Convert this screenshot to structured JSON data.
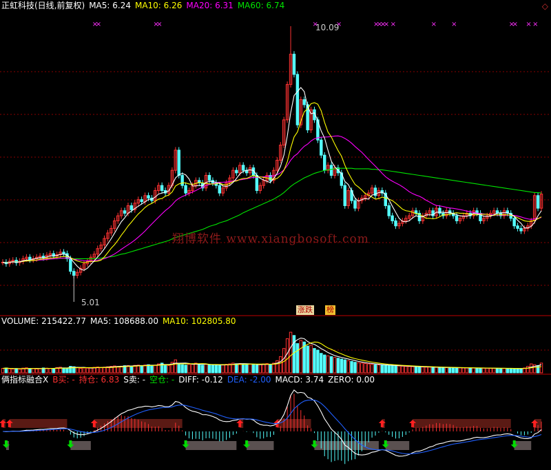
{
  "header": {
    "name": "正虹科技(日线,前复权)",
    "ma5": "MA5: 6.24",
    "ma10": "MA10: 6.26",
    "ma20": "MA20: 6.31",
    "ma60": "MA60: 6.74"
  },
  "annotations": {
    "high": "10.09",
    "low": "5.01",
    "watermark": "翔博软件 www.xiangbosoft.com",
    "badge_updown": "涨跌",
    "badge_rank": "榜"
  },
  "volume_header": {
    "volume": "VOLUME: 215422.77",
    "ma5": "MA5: 108688.00",
    "ma10": "MA10: 102805.80"
  },
  "indicator_header": {
    "name": "俩指标融合X",
    "b_sell": "B买: -",
    "hold": "持仓: 6.83",
    "s_sell": "S卖: -",
    "empty": "空仓: -",
    "diff": "DIFF: -0.12",
    "dea": "DEA: -2.00",
    "macd": "MACD: 3.74",
    "zero": "ZERO: 0.00"
  },
  "colors": {
    "up": "#ff3232",
    "down": "#54ffff",
    "ma5": "#ffffff",
    "ma10": "#ffff00",
    "ma20": "#ff00ff",
    "ma60": "#00e600",
    "grid": "#8b0000",
    "dea": "#2060ff",
    "buy_arrow": "#ff2020",
    "sell_arrow": "#00dd00",
    "hold_box": "#5a1a14",
    "empty_box": "#5a5050"
  },
  "chart_data": {
    "type": "candlestick",
    "price_ylim": [
      4.6,
      10.4
    ],
    "x": [
      1,
      2,
      3,
      4,
      5,
      6,
      7,
      8,
      9,
      10,
      11,
      12,
      13,
      14,
      15,
      16,
      17,
      18,
      19,
      20,
      21,
      22,
      23,
      24,
      25,
      26,
      27,
      28,
      29,
      30,
      31,
      32,
      33,
      34,
      35,
      36,
      37,
      38,
      39,
      40,
      41,
      42,
      43,
      44,
      45,
      46,
      47,
      48,
      49,
      50,
      51,
      52,
      53,
      54,
      55,
      56,
      57,
      58,
      59,
      60,
      61,
      62,
      63,
      64,
      65,
      66,
      67,
      68,
      69,
      70,
      71,
      72,
      73,
      74,
      75,
      76,
      77,
      78,
      79,
      80,
      81,
      82,
      83,
      84,
      85,
      86,
      87,
      88,
      89,
      90,
      91,
      92,
      93,
      94,
      95,
      96,
      97,
      98,
      99,
      100,
      101,
      102,
      103,
      104,
      105,
      106,
      107,
      108,
      109,
      110,
      111,
      112,
      113,
      114,
      115,
      116,
      117,
      118,
      119,
      120,
      121,
      122,
      123,
      124,
      125,
      126,
      127,
      128,
      129,
      130,
      131,
      132,
      133,
      134,
      135,
      136,
      137,
      138,
      139,
      140,
      141,
      142,
      143,
      144,
      145,
      146,
      147,
      148,
      149,
      150,
      151,
      152,
      153,
      154,
      155,
      156,
      157,
      158,
      159,
      160
    ],
    "close": [
      5.48,
      5.45,
      5.5,
      5.52,
      5.47,
      5.5,
      5.55,
      5.58,
      5.53,
      5.55,
      5.58,
      5.6,
      5.57,
      5.62,
      5.65,
      5.6,
      5.63,
      5.68,
      5.65,
      5.55,
      5.3,
      5.22,
      5.28,
      5.36,
      5.45,
      5.5,
      5.58,
      5.64,
      5.75,
      5.82,
      5.95,
      6.06,
      6.15,
      6.3,
      6.4,
      6.5,
      6.45,
      6.6,
      6.52,
      6.65,
      6.72,
      6.68,
      6.8,
      6.75,
      6.7,
      6.9,
      7.0,
      6.9,
      6.85,
      7.0,
      7.3,
      7.7,
      7.2,
      7.0,
      6.85,
      6.9,
      7.0,
      7.1,
      7.05,
      6.95,
      7.2,
      7.1,
      7.05,
      7.0,
      6.85,
      6.95,
      7.05,
      7.15,
      7.3,
      7.25,
      7.4,
      7.3,
      7.25,
      7.35,
      7.2,
      6.9,
      7.0,
      7.1,
      7.2,
      7.1,
      7.3,
      7.5,
      7.8,
      8.3,
      9.0,
      9.6,
      9.2,
      8.2,
      8.7,
      8.6,
      8.1,
      8.5,
      8.3,
      7.9,
      7.6,
      7.3,
      7.4,
      7.2,
      7.35,
      7.25,
      7.0,
      6.6,
      6.9,
      6.7,
      6.55,
      6.7,
      6.75,
      6.8,
      6.85,
      6.95,
      6.8,
      6.9,
      6.85,
      6.6,
      6.4,
      6.3,
      6.2,
      6.25,
      6.3,
      6.35,
      6.4,
      6.5,
      6.45,
      6.3,
      6.4,
      6.45,
      6.5,
      6.4,
      6.55,
      6.45,
      6.4,
      6.5,
      6.45,
      6.4,
      6.3,
      6.35,
      6.4,
      6.45,
      6.4,
      6.5,
      6.45,
      6.3,
      6.35,
      6.4,
      6.45,
      6.5,
      6.45,
      6.4,
      6.5,
      6.45,
      6.35,
      6.2,
      6.15,
      6.1,
      6.15,
      6.2,
      6.3,
      6.8,
      6.55,
      6.83
    ],
    "ma5": [
      5.48,
      5.465,
      5.477,
      5.488,
      5.484,
      5.488,
      5.508,
      5.524,
      5.526,
      5.542,
      5.558,
      5.568,
      5.566,
      5.584,
      5.604,
      5.608,
      5.614,
      5.636,
      5.642,
      5.622,
      5.562,
      5.476,
      5.4,
      5.342,
      5.322,
      5.362,
      5.434,
      5.506,
      5.584,
      5.658,
      5.748,
      5.844,
      5.944,
      6.056,
      6.172,
      6.282,
      6.36,
      6.45,
      6.494,
      6.544,
      6.588,
      6.634,
      6.674,
      6.724,
      6.73,
      6.77,
      6.83,
      6.85,
      6.87,
      6.89,
      7.01,
      7.15,
      7.21,
      7.24,
      7.21,
      7.13,
      6.99,
      6.99,
      7.0,
      7.0,
      7.06,
      7.08,
      7.08,
      7.06,
      7.04,
      6.99,
      6.98,
      7.0,
      7.06,
      7.14,
      7.23,
      7.28,
      7.3,
      7.31,
      7.3,
      7.2,
      7.14,
      7.11,
      7.08,
      7.06,
      7.14,
      7.24,
      7.38,
      7.6,
      7.98,
      8.44,
      8.78,
      8.86,
      8.94,
      8.86,
      8.56,
      8.42,
      8.44,
      8.28,
      8.08,
      7.94,
      7.7,
      7.48,
      7.37,
      7.3,
      7.24,
      7.08,
      7.02,
      6.89,
      6.75,
      6.69,
      6.72,
      6.74,
      6.73,
      6.81,
      6.83,
      6.86,
      6.87,
      6.82,
      6.72,
      6.59,
      6.47,
      6.35,
      6.29,
      6.28,
      6.3,
      6.36,
      6.4,
      6.38,
      6.38,
      6.42,
      6.42,
      6.42,
      6.47,
      6.47,
      6.47,
      6.46,
      6.47,
      6.44,
      6.42,
      6.4,
      6.39,
      6.39,
      6.41,
      6.45,
      6.44,
      6.42,
      6.39,
      6.39,
      6.39,
      6.42,
      6.45,
      6.46,
      6.46,
      6.46,
      6.43,
      6.39,
      6.31,
      6.25,
      6.16,
      6.16,
      6.19,
      6.27,
      6.4,
      6.5
    ],
    "ma10": [
      5.48,
      5.465,
      5.477,
      5.488,
      5.484,
      5.487,
      5.496,
      5.506,
      5.506,
      5.513,
      5.523,
      5.538,
      5.545,
      5.555,
      5.563,
      5.568,
      5.576,
      5.586,
      5.594,
      5.594,
      5.571,
      5.533,
      5.504,
      5.487,
      5.472,
      5.485,
      5.498,
      5.494,
      5.502,
      5.52,
      5.586,
      5.67,
      5.756,
      5.828,
      5.915,
      6.015,
      6.102,
      6.197,
      6.275,
      6.358,
      6.435,
      6.497,
      6.565,
      6.615,
      6.645,
      6.685,
      6.73,
      6.742,
      6.787,
      6.81,
      6.87,
      6.99,
      7.03,
      7.05,
      7.05,
      7.03,
      7.02,
      7.04,
      7.06,
      7.05,
      7.04,
      7.03,
      7.03,
      7.03,
      7.05,
      7.02,
      7.01,
      7.04,
      7.08,
      7.09,
      7.12,
      7.14,
      7.14,
      7.17,
      7.2,
      7.17,
      7.17,
      7.16,
      7.15,
      7.13,
      7.12,
      7.14,
      7.2,
      7.3,
      7.47,
      7.74,
      7.96,
      8.06,
      8.27,
      8.46,
      8.52,
      8.62,
      8.64,
      8.61,
      8.48,
      8.25,
      8.06,
      7.96,
      7.82,
      7.69,
      7.58,
      7.4,
      7.25,
      7.13,
      7.02,
      6.97,
      6.91,
      6.84,
      6.81,
      6.77,
      6.73,
      6.74,
      6.77,
      6.75,
      6.73,
      6.7,
      6.65,
      6.59,
      6.53,
      6.5,
      6.49,
      6.47,
      6.44,
      6.43,
      6.39,
      6.35,
      6.35,
      6.34,
      6.35,
      6.38,
      6.42,
      6.42,
      6.43,
      6.45,
      6.46,
      6.45,
      6.45,
      6.44,
      6.43,
      6.42,
      6.42,
      6.43,
      6.43,
      6.43,
      6.41,
      6.41,
      6.42,
      6.42,
      6.42,
      6.42,
      6.41,
      6.39,
      6.36,
      6.33,
      6.3,
      6.29,
      6.29,
      6.31,
      6.34,
      6.38
    ],
    "ma20": [
      5.48,
      5.465,
      5.477,
      5.488,
      5.484,
      5.487,
      5.496,
      5.506,
      5.506,
      5.511,
      5.518,
      5.525,
      5.529,
      5.536,
      5.544,
      5.547,
      5.552,
      5.559,
      5.563,
      5.563,
      5.553,
      5.541,
      5.529,
      5.521,
      5.511,
      5.508,
      5.509,
      5.511,
      5.522,
      5.536,
      5.551,
      5.577,
      5.608,
      5.643,
      5.688,
      5.736,
      5.781,
      5.826,
      5.87,
      5.92,
      5.976,
      6.035,
      6.098,
      6.17,
      6.237,
      6.306,
      6.373,
      6.439,
      6.503,
      6.556,
      6.618,
      6.695,
      6.744,
      6.781,
      6.809,
      6.842,
      6.869,
      6.9,
      6.936,
      6.967,
      7.0,
      7.02,
      7.035,
      7.054,
      7.063,
      7.065,
      7.069,
      7.076,
      7.088,
      7.101,
      7.112,
      7.121,
      7.133,
      7.149,
      7.162,
      7.162,
      7.167,
      7.172,
      7.177,
      7.183,
      7.193,
      7.214,
      7.252,
      7.309,
      7.395,
      7.501,
      7.579,
      7.629,
      7.708,
      7.776,
      7.819,
      7.881,
      7.925,
      7.944,
      7.956,
      7.959,
      7.961,
      7.969,
      7.978,
      7.982,
      7.966,
      7.932,
      7.889,
      7.837,
      7.772,
      7.714,
      7.657,
      7.587,
      7.516,
      7.449,
      7.382,
      7.314,
      7.241,
      7.174,
      7.125,
      7.086,
      7.049,
      7.016,
      6.975,
      6.928,
      6.876,
      6.839,
      6.81,
      6.787,
      6.751,
      6.707,
      6.672,
      6.633,
      6.604,
      6.596,
      6.583,
      6.566,
      6.554,
      6.547,
      6.535,
      6.523,
      6.509,
      6.493,
      6.479,
      6.466,
      6.452,
      6.443,
      6.436,
      6.428,
      6.421,
      6.414,
      6.413,
      6.414,
      6.413,
      6.413,
      6.412,
      6.408,
      6.394,
      6.377,
      6.355,
      6.338,
      6.327,
      6.34,
      6.349,
      6.366
    ],
    "ma60": [
      5.48,
      5.47,
      5.48,
      5.49,
      5.49,
      5.49,
      5.5,
      5.51,
      5.51,
      5.51,
      5.52,
      5.53,
      5.53,
      5.54,
      5.54,
      5.55,
      5.55,
      5.56,
      5.56,
      5.56,
      5.56,
      5.55,
      5.55,
      5.55,
      5.55,
      5.55,
      5.55,
      5.55,
      5.56,
      5.56,
      5.57,
      5.58,
      5.59,
      5.6,
      5.62,
      5.64,
      5.65,
      5.67,
      5.69,
      5.71,
      5.73,
      5.75,
      5.77,
      5.79,
      5.81,
      5.83,
      5.85,
      5.87,
      5.89,
      5.91,
      5.94,
      5.97,
      5.99,
      6.01,
      6.03,
      6.05,
      6.07,
      6.09,
      6.11,
      6.13,
      6.16,
      6.19,
      6.21,
      6.23,
      6.26,
      6.28,
      6.3,
      6.33,
      6.36,
      6.39,
      6.42,
      6.46,
      6.49,
      6.52,
      6.55,
      6.58,
      6.61,
      6.64,
      6.67,
      6.7,
      6.73,
      6.77,
      6.81,
      6.86,
      6.92,
      6.98,
      7.03,
      7.07,
      7.11,
      7.15,
      7.18,
      7.21,
      7.24,
      7.26,
      7.28,
      7.3,
      7.31,
      7.32,
      7.33,
      7.34,
      7.34,
      7.34,
      7.34,
      7.34,
      7.33,
      7.33,
      7.33,
      7.33,
      7.33,
      7.32,
      7.32,
      7.31,
      7.31,
      7.3,
      7.29,
      7.28,
      7.27,
      7.26,
      7.25,
      7.24,
      7.23,
      7.22,
      7.21,
      7.2,
      7.19,
      7.18,
      7.17,
      7.16,
      7.15,
      7.14,
      7.13,
      7.12,
      7.11,
      7.1,
      7.09,
      7.08,
      7.07,
      7.06,
      7.05,
      7.04,
      7.03,
      7.02,
      7.01,
      7.0,
      6.99,
      6.98,
      6.97,
      6.96,
      6.95,
      6.94,
      6.93,
      6.92,
      6.91,
      6.9,
      6.89,
      6.88,
      6.87,
      6.86,
      6.86,
      6.85
    ],
    "volume": [
      55,
      60,
      50,
      48,
      52,
      45,
      58,
      62,
      50,
      55,
      48,
      52,
      60,
      58,
      55,
      50,
      65,
      70,
      60,
      55,
      80,
      75,
      65,
      55,
      60,
      58,
      62,
      68,
      72,
      65,
      70,
      75,
      80,
      85,
      78,
      82,
      88,
      90,
      84,
      92,
      95,
      88,
      96,
      100,
      90,
      95,
      110,
      120,
      95,
      90,
      130,
      160,
      115,
      100,
      95,
      105,
      110,
      120,
      100,
      95,
      105,
      100,
      98,
      95,
      90,
      100,
      105,
      110,
      120,
      112,
      115,
      108,
      104,
      110,
      100,
      95,
      100,
      110,
      115,
      105,
      120,
      150,
      200,
      300,
      420,
      500,
      460,
      360,
      400,
      380,
      330,
      340,
      300,
      280,
      240,
      220,
      210,
      200,
      190,
      180,
      170,
      160,
      150,
      140,
      130,
      125,
      120,
      115,
      110,
      105,
      100,
      98,
      95,
      92,
      90,
      88,
      86,
      84,
      82,
      80,
      78,
      76,
      75,
      74,
      72,
      70,
      70,
      68,
      68,
      66,
      66,
      65,
      64,
      63,
      62,
      62,
      61,
      60,
      60,
      59,
      58,
      58,
      57,
      57,
      56,
      56,
      55,
      55,
      54,
      54,
      53,
      53,
      52,
      52,
      60,
      80,
      110,
      100,
      90,
      120
    ],
    "volume_ylim": [
      0,
      560
    ],
    "macd_ylim": [
      -3.5,
      3.2
    ]
  }
}
